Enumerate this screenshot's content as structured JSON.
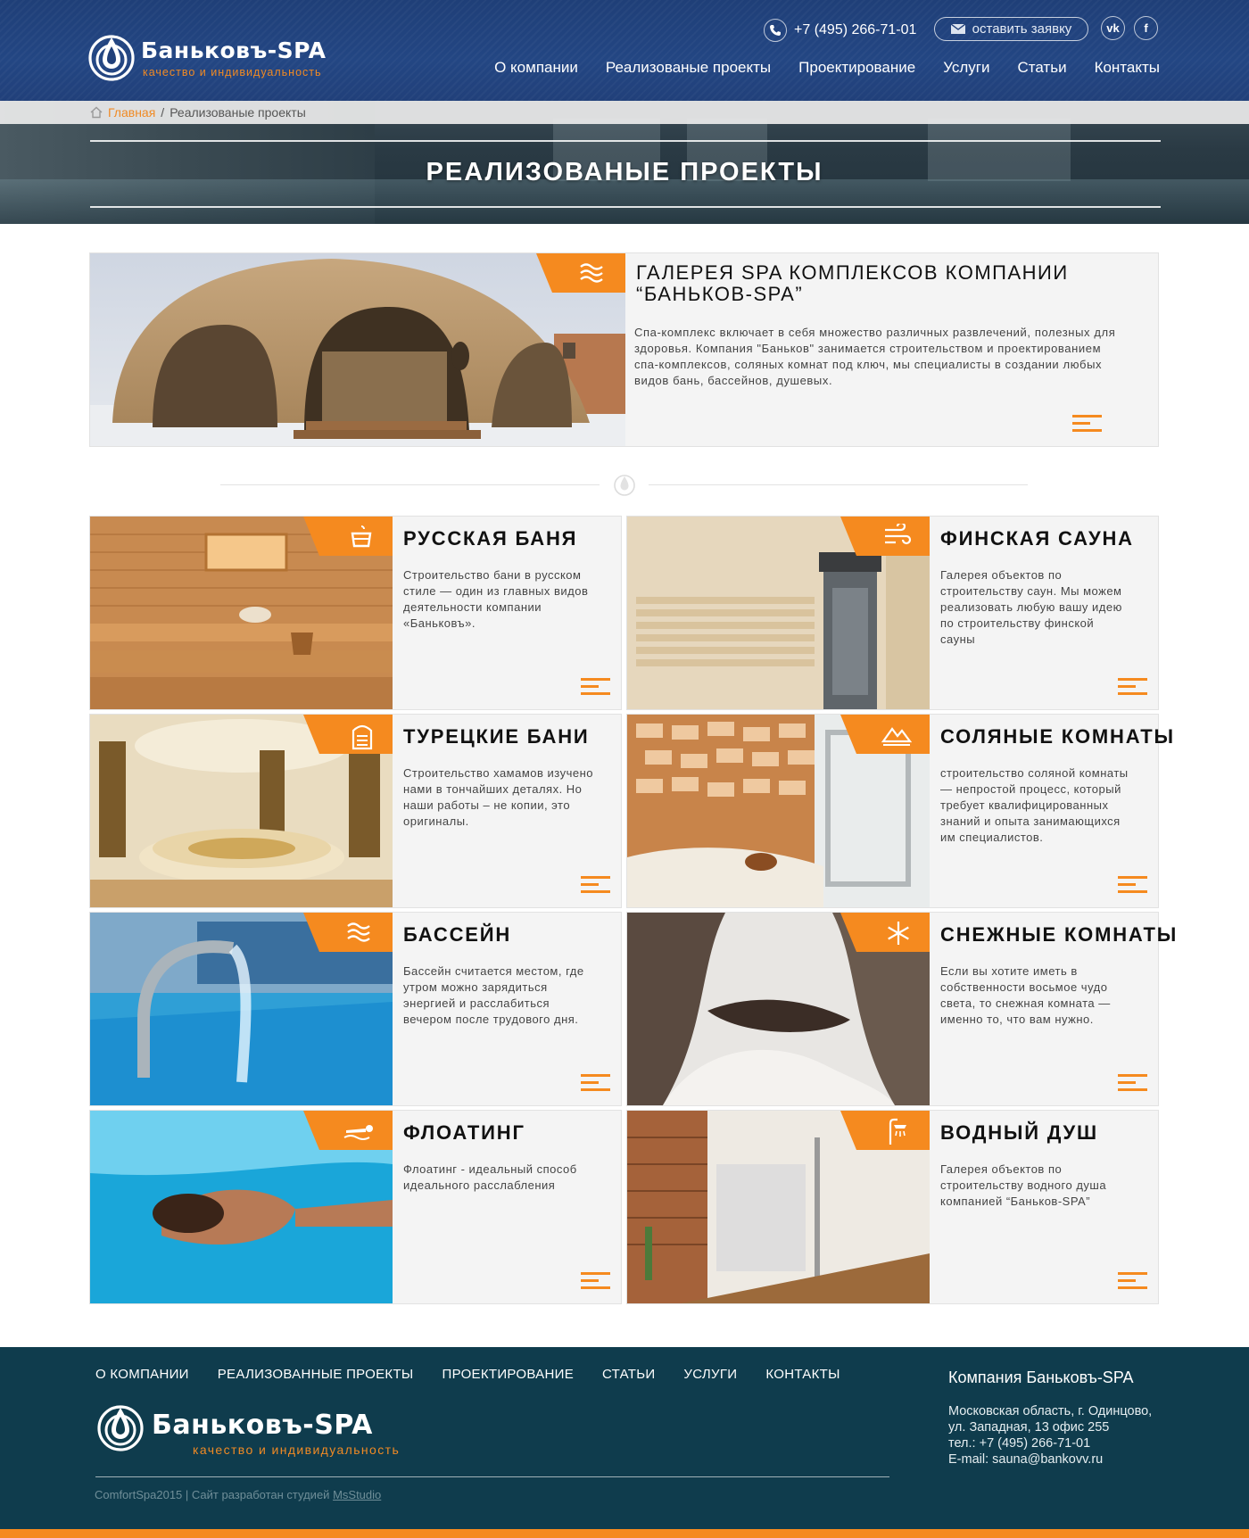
{
  "brand": {
    "name": "Баньковъ-SPA",
    "tagline": "качество и индивидуальность"
  },
  "header": {
    "phone": "+7 (495) 266-71-01",
    "request_label": "оставить заявку",
    "social": {
      "vk": "vk",
      "fb": "f"
    },
    "nav": [
      "О компании",
      "Реализованые проекты",
      "Проектирование",
      "Услуги",
      "Статьи",
      "Контакты"
    ]
  },
  "breadcrumb": {
    "home": "Главная",
    "separator": "/",
    "current": "Реализованые проекты"
  },
  "hero": {
    "title": "РЕАЛИЗОВАНЫЕ ПРОЕКТЫ"
  },
  "featured": {
    "title": "ГАЛЕРЕЯ SPA КОМПЛЕКСОВ КОМПАНИИ “БАНЬКОВ-SPA”",
    "description": "Спа-комплекс включает в себя множество различных развлечений, полезных для здоровья. Компания \"Баньков\" занимается строительством и проектированием спа-комплексов, соляных комнат под ключ, мы специалисты в создании любых видов бань, бассейнов, душевых.",
    "icon": "waves-icon"
  },
  "cards": [
    {
      "title": "РУССКАЯ БАНЯ",
      "description": "Строительство бани в русском стиле — один из главных видов деятельности компании «Баньковъ».",
      "icon": "bucket-icon"
    },
    {
      "title": "ФИНСКАЯ САУНА",
      "description": "Галерея объектов по строительству саун. Мы можем реализовать любую вашу идею по строительству финской сауны",
      "icon": "steam-icon"
    },
    {
      "title": "ТУРЕЦКИЕ БАНИ",
      "description": "Строительство хамамов изучено нами в тончайших деталях. Но наши работы – не копии, это оригиналы.",
      "icon": "hamam-icon"
    },
    {
      "title": "СОЛЯНЫЕ КОМНАТЫ",
      "description": "строительство соляной комнаты — непростой процесс, который требует квалифицированных знаний и опыта занимающихся им специалистов.",
      "icon": "mountains-icon"
    },
    {
      "title": "БАССЕЙН",
      "description": "Бассейн считается местом, где утром можно зарядиться энергией и расслабиться вечером после трудового дня.",
      "icon": "water-icon"
    },
    {
      "title": "СНЕЖНЫЕ КОМНАТЫ",
      "description": "Если вы хотите иметь в собственности восьмое чудо света, то снежная комната — именно то, что вам нужно.",
      "icon": "snowflake-icon"
    },
    {
      "title": "ФЛОАТИНГ",
      "description": "Флоатинг - идеальный способ идеального расслабления",
      "icon": "floating-icon"
    },
    {
      "title": "ВОДНЫЙ ДУШ",
      "description": "Галерея объектов по строительству водного душа компанией “Баньков-SPA”",
      "icon": "shower-icon"
    }
  ],
  "footer": {
    "nav": [
      "О КОМПАНИИ",
      "РЕАЛИЗОВАННЫЕ ПРОЕКТЫ",
      "ПРОЕКТИРОВАНИЕ",
      "СТАТЬИ",
      "УСЛУГИ",
      "КОНТАКТЫ"
    ],
    "copyright": "ComfortSpa2015 | Сайт разработан студией",
    "studio": "MsStudio",
    "company": "Компания Баньковъ-SPA",
    "address_line1": "Московская область, г. Одинцово,",
    "address_line2": "ул. Западная, 13 офис 255",
    "phone": "тел.: +7 (495) 266-71-01",
    "email": "E-mail: sauna@bankovv.ru"
  },
  "colors": {
    "header_bg": "#21407a",
    "accent": "#f58a1f",
    "footer_bg": "#0f3c4d",
    "card_bg": "#f4f4f4"
  }
}
